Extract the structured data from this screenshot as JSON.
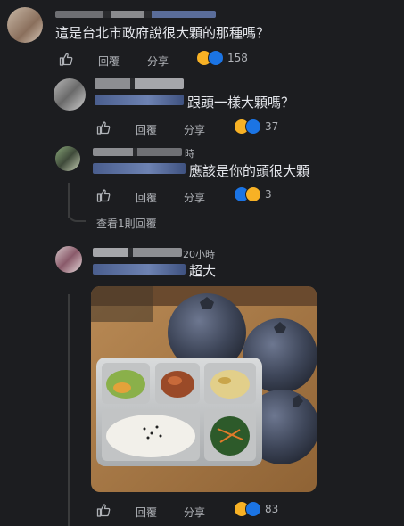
{
  "comment1": {
    "text": "這是台北市政府說很大顆的那種嗎？",
    "reply_label": "回覆",
    "share_label": "分享",
    "reaction_count": "158"
  },
  "comment2": {
    "text": "跟頭一樣大顆嗎？",
    "reply_label": "回覆",
    "share_label": "分享",
    "reaction_count": "37"
  },
  "comment3": {
    "time_fragment": "時",
    "text": "應該是你的頭很大顆",
    "reply_label": "回覆",
    "share_label": "分享",
    "reaction_count": "3",
    "view_replies": "查看1則回覆"
  },
  "comment4": {
    "time_fragment": "20小時",
    "text": "超大",
    "reply_label": "回覆",
    "share_label": "分享",
    "reaction_count": "83"
  },
  "icons": {
    "like": "thumbs-up-icon",
    "haha": "haha-emoji-icon",
    "like_reaction": "like-reaction-icon"
  },
  "colors": {
    "background": "#1c1d20",
    "text": "#e4e6eb",
    "secondary": "#b0b3b8",
    "like_blue": "#1b74e4",
    "haha_yellow": "#f7b125"
  }
}
